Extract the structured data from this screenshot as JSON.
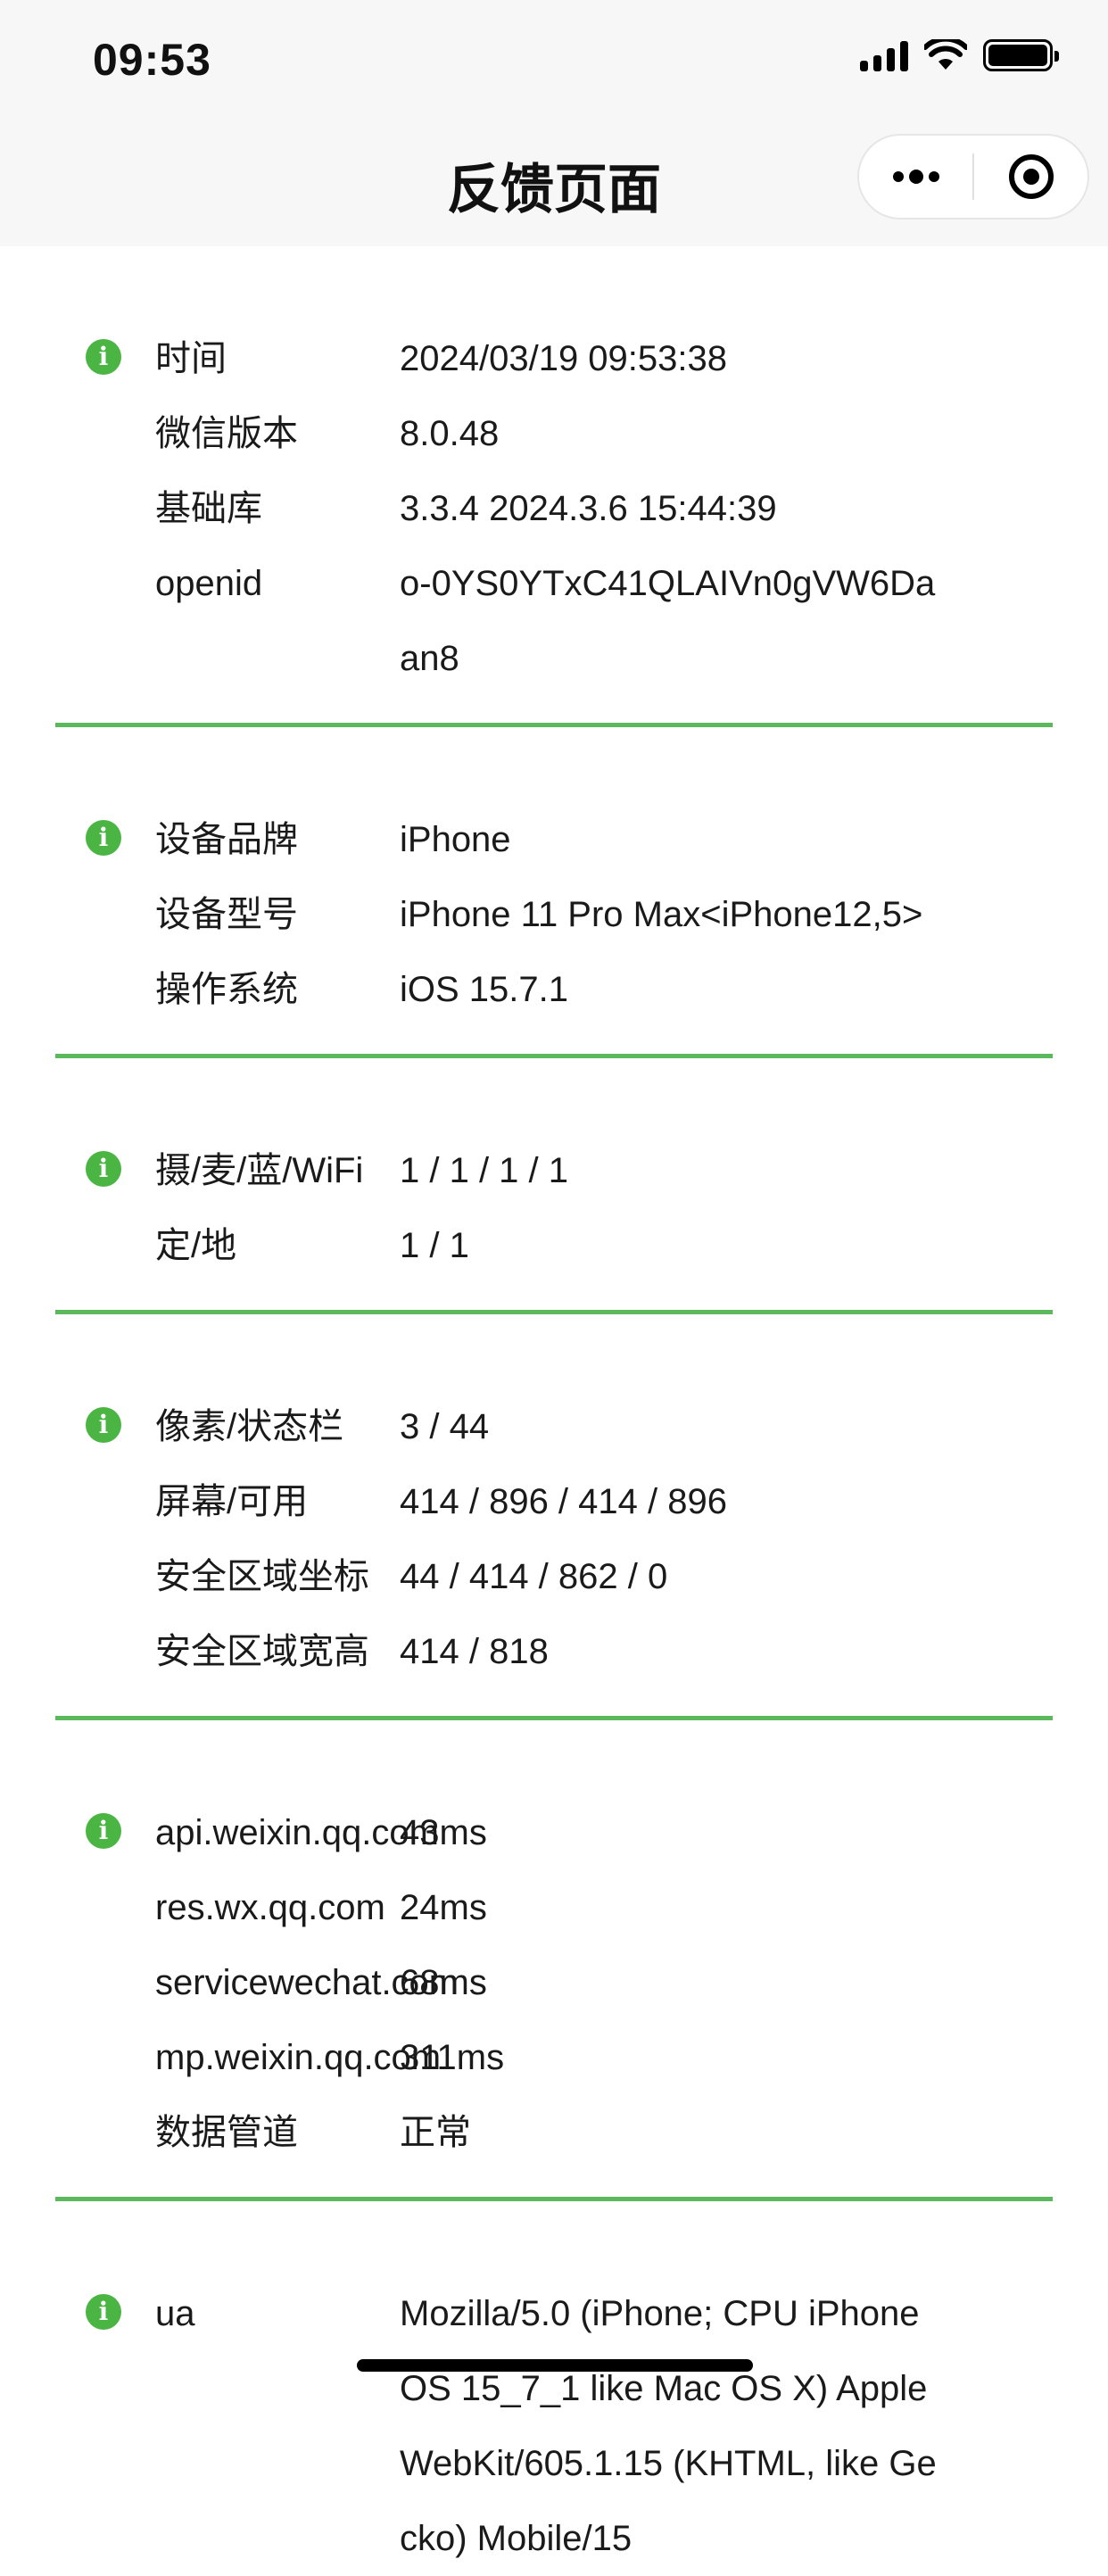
{
  "status": {
    "time": "09:53"
  },
  "nav": {
    "title": "反馈页面"
  },
  "sections": [
    {
      "rows": [
        {
          "k": "时间",
          "v": "2024/03/19 09:53:38"
        },
        {
          "k": "微信版本",
          "v": "8.0.48"
        },
        {
          "k": "基础库",
          "v": "3.3.4 2024.3.6 15:44:39"
        },
        {
          "k": "openid",
          "v": "o-0YS0YTxC41QLAIVn0gVW6Daan8"
        }
      ]
    },
    {
      "rows": [
        {
          "k": "设备品牌",
          "v": "iPhone"
        },
        {
          "k": "设备型号",
          "v": "iPhone 11 Pro Max<iPhone12,5>"
        },
        {
          "k": "操作系统",
          "v": "iOS 15.7.1"
        }
      ]
    },
    {
      "rows": [
        {
          "k": "摄/麦/蓝/WiFi",
          "v": "1 / 1 / 1 / 1"
        },
        {
          "k": "定/地",
          "v": "1 / 1"
        }
      ]
    },
    {
      "rows": [
        {
          "k": "像素/状态栏",
          "v": "3 / 44"
        },
        {
          "k": "屏幕/可用",
          "v": "414 / 896 / 414 / 896"
        },
        {
          "k": "安全区域坐标",
          "v": "44 / 414 / 862 / 0"
        },
        {
          "k": "安全区域宽高",
          "v": "414 / 818"
        }
      ]
    },
    {
      "rows": [
        {
          "k": "api.weixin.qq.com",
          "v": "43ms"
        },
        {
          "k": "res.wx.qq.com",
          "v": "24ms"
        },
        {
          "k": "servicewechat.com",
          "v": "68ms"
        },
        {
          "k": "mp.weixin.qq.com",
          "v": "311ms"
        },
        {
          "k": "数据管道",
          "v": "正常"
        }
      ]
    },
    {
      "rows": [
        {
          "k": "ua",
          "v": "Mozilla/5.0 (iPhone; CPU iPhone OS 15_7_1 like Mac OS X) AppleWebKit/605.1.15 (KHTML, like Gecko) Mobile/15"
        }
      ]
    }
  ],
  "icons": {
    "info": "info-icon",
    "accent": "#4bb543",
    "divider": "#5cb85c"
  }
}
